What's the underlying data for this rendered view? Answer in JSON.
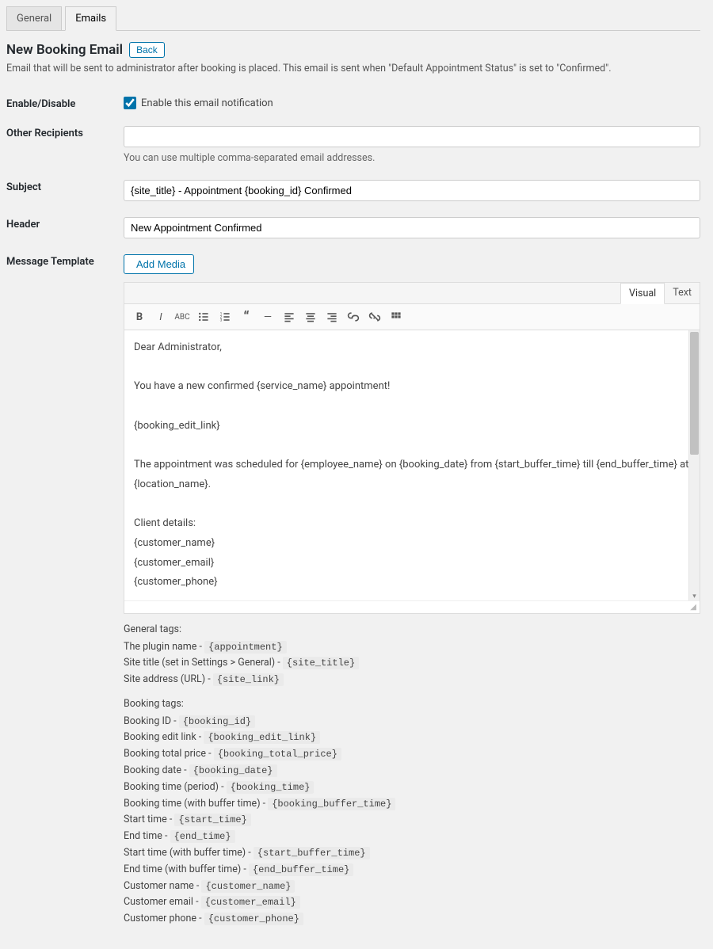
{
  "tabs": {
    "general": "General",
    "emails": "Emails"
  },
  "title": "New Booking Email",
  "back": "Back",
  "description": "Email that will be sent to administrator after booking is placed. This email is sent when \"Default Appointment Status\" is set to \"Confirmed\".",
  "labels": {
    "enable": "Enable/Disable",
    "recipients": "Other Recipients",
    "subject": "Subject",
    "header": "Header",
    "template": "Message Template"
  },
  "fields": {
    "enable_label": "Enable this email notification",
    "recipients_value": "",
    "recipients_hint": "You can use multiple comma-separated email addresses.",
    "subject_value": "{site_title} - Appointment {booking_id} Confirmed",
    "header_value": "New Appointment Confirmed"
  },
  "editor": {
    "add_media": "Add Media",
    "tab_visual": "Visual",
    "tab_text": "Text",
    "body": "Dear Administrator,\n\nYou have a new confirmed {service_name} appointment!\n\n{booking_edit_link}\n\nThe appointment was scheduled for {employee_name} on {booking_date} from {start_buffer_time} till {end_buffer_time} at {location_name}.\n\nClient details:\n{customer_name}\n{customer_email}\n{customer_phone}"
  },
  "tags": {
    "general_heading": "General tags:",
    "general": [
      {
        "label": "The plugin name - ",
        "tag": "{appointment}"
      },
      {
        "label": "Site title (set in Settings > General) - ",
        "tag": "{site_title}"
      },
      {
        "label": "Site address (URL) - ",
        "tag": "{site_link}"
      }
    ],
    "booking_heading": "Booking tags:",
    "booking": [
      {
        "label": "Booking ID - ",
        "tag": "{booking_id}"
      },
      {
        "label": "Booking edit link - ",
        "tag": "{booking_edit_link}"
      },
      {
        "label": "Booking total price - ",
        "tag": "{booking_total_price}"
      },
      {
        "label": "Booking date - ",
        "tag": "{booking_date}"
      },
      {
        "label": "Booking time (period) - ",
        "tag": "{booking_time}"
      },
      {
        "label": "Booking time (with buffer time) - ",
        "tag": "{booking_buffer_time}"
      },
      {
        "label": "Start time - ",
        "tag": "{start_time}"
      },
      {
        "label": "End time - ",
        "tag": "{end_time}"
      },
      {
        "label": "Start time (with buffer time) - ",
        "tag": "{start_buffer_time}"
      },
      {
        "label": "End time (with buffer time) - ",
        "tag": "{end_buffer_time}"
      },
      {
        "label": "Customer name - ",
        "tag": "{customer_name}"
      },
      {
        "label": "Customer email - ",
        "tag": "{customer_email}"
      },
      {
        "label": "Customer phone - ",
        "tag": "{customer_phone}"
      }
    ]
  }
}
